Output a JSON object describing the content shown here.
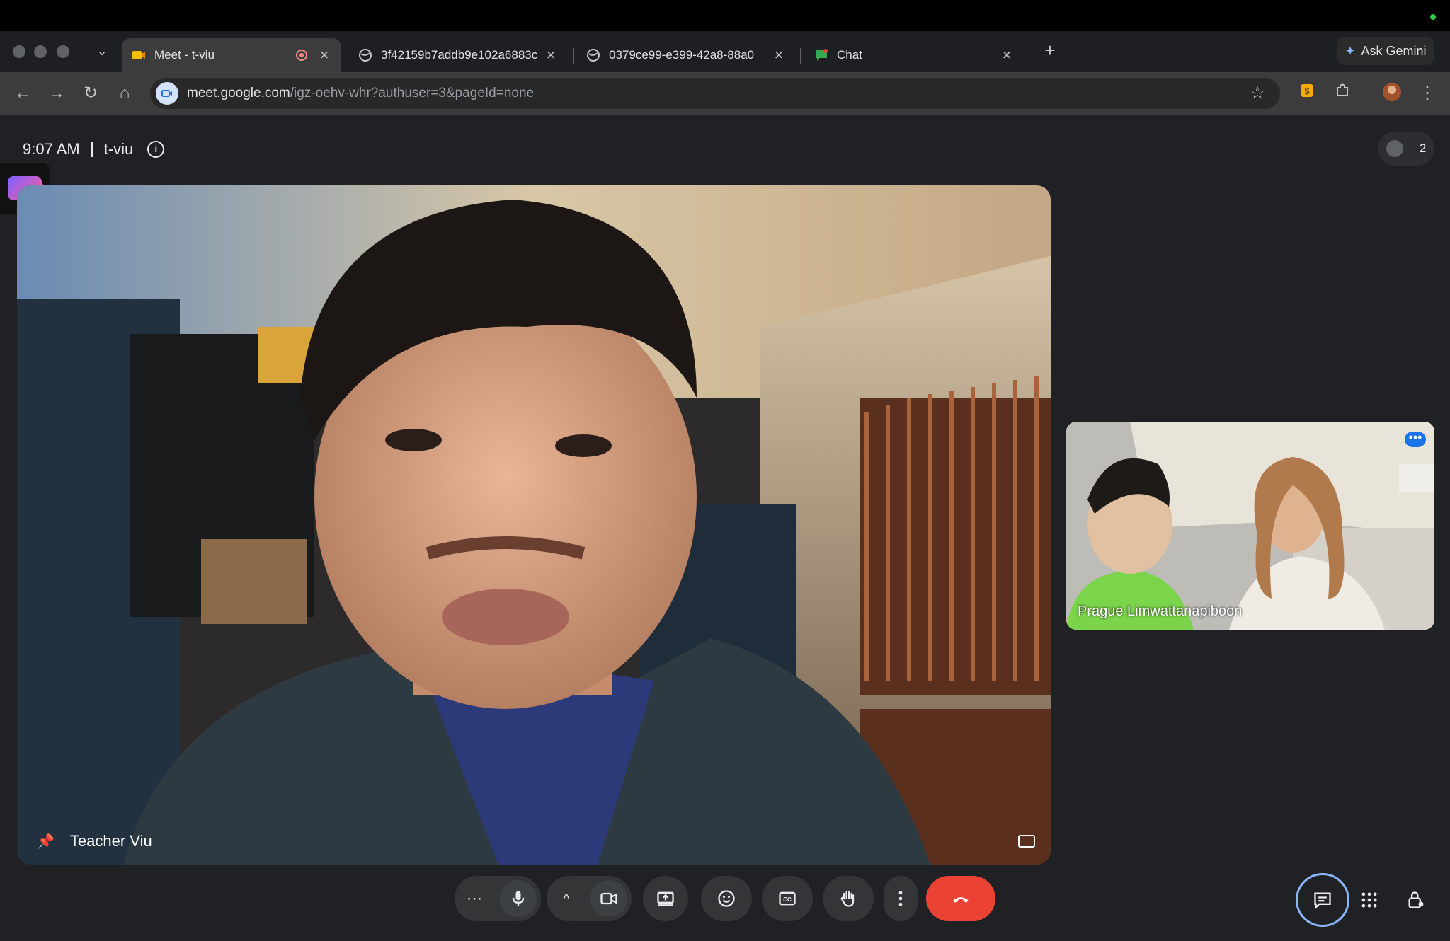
{
  "browser": {
    "tabs": [
      {
        "title": "Meet - t-viu",
        "active": true,
        "recording": true
      },
      {
        "title": "3f42159b7addb9e102a6883c",
        "active": false
      },
      {
        "title": "0379ce99-e399-42a8-88a0",
        "active": false
      },
      {
        "title": "Chat",
        "active": false
      }
    ],
    "ask_gemini": "Ask Gemini",
    "url_host": "meet.google.com",
    "url_path": "/igz-oehv-whr?authuser=3&pageId=none"
  },
  "meet": {
    "time": "9:07 AM",
    "meeting_code": "t-viu",
    "participant_count": "2",
    "main_speaker": "Teacher Viu",
    "side_participant": "Prague Limwattanapiboon"
  },
  "colors": {
    "end_call": "#ea4335",
    "accent": "#8ab4f8"
  }
}
